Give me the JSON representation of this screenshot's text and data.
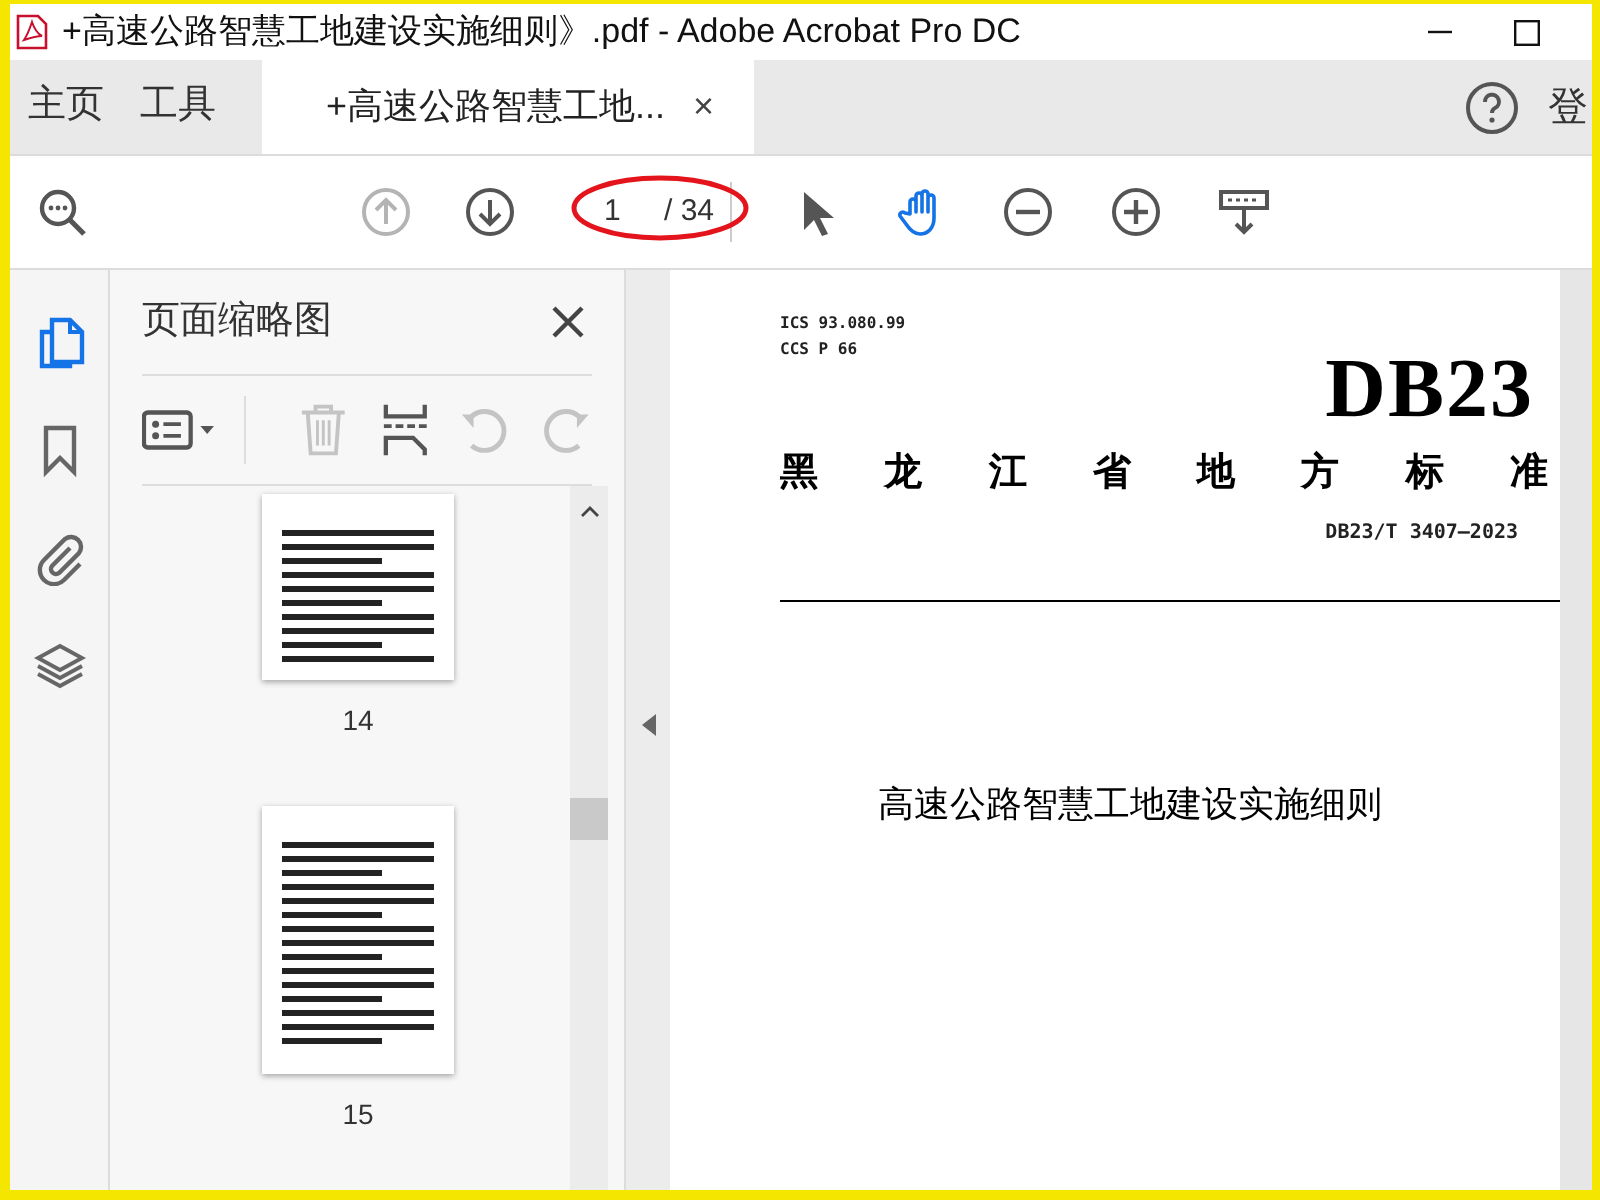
{
  "window": {
    "title": "+高速公路智慧工地建设实施细则》.pdf - Adobe Acrobat Pro DC"
  },
  "tabs": [
    {
      "label": "主页",
      "selected": false
    },
    {
      "label": "工具",
      "selected": false
    },
    {
      "label": "+高速公路智慧工地...",
      "selected": true,
      "close": "×"
    }
  ],
  "account": {
    "label": "登"
  },
  "toolbar": {
    "buttons": [
      {
        "kind": "search",
        "disabled": false
      },
      {
        "kind": "prev",
        "disabled": true
      },
      {
        "kind": "next",
        "disabled": false
      }
    ],
    "page_field": {
      "value": "1",
      "circled": true
    },
    "page_total": "/ 34",
    "tools": [
      {
        "kind": "pointer",
        "selected": false
      },
      {
        "kind": "hand",
        "selected": true
      },
      {
        "kind": "zoom_out",
        "selected": false
      },
      {
        "kind": "zoom_in",
        "selected": false
      },
      {
        "kind": "keyboard",
        "selected": false
      }
    ]
  },
  "sidebar": {
    "items": [
      {
        "kind": "pages",
        "selected": true
      },
      {
        "kind": "bookmark",
        "selected": false
      },
      {
        "kind": "attachment",
        "selected": false
      },
      {
        "kind": "layers",
        "selected": false
      }
    ]
  },
  "panel": {
    "title": "页面缩略图",
    "tools": [
      {
        "kind": "options",
        "disabled": false
      },
      {
        "kind": "delete",
        "disabled": true
      },
      {
        "kind": "insert",
        "disabled": false
      },
      {
        "kind": "rotate_left",
        "disabled": true
      },
      {
        "kind": "rotate_right",
        "disabled": true
      }
    ],
    "thumbnails": [
      {
        "label": "14"
      },
      {
        "label": "15"
      }
    ]
  },
  "document": {
    "ics": "ICS 93.080.99",
    "ccs": "CCS P 66",
    "code": "DB23",
    "category": "黑龙江省地方标准",
    "number": "DB23/T 3407—2023",
    "title": "高速公路智慧工地建设实施细则"
  }
}
